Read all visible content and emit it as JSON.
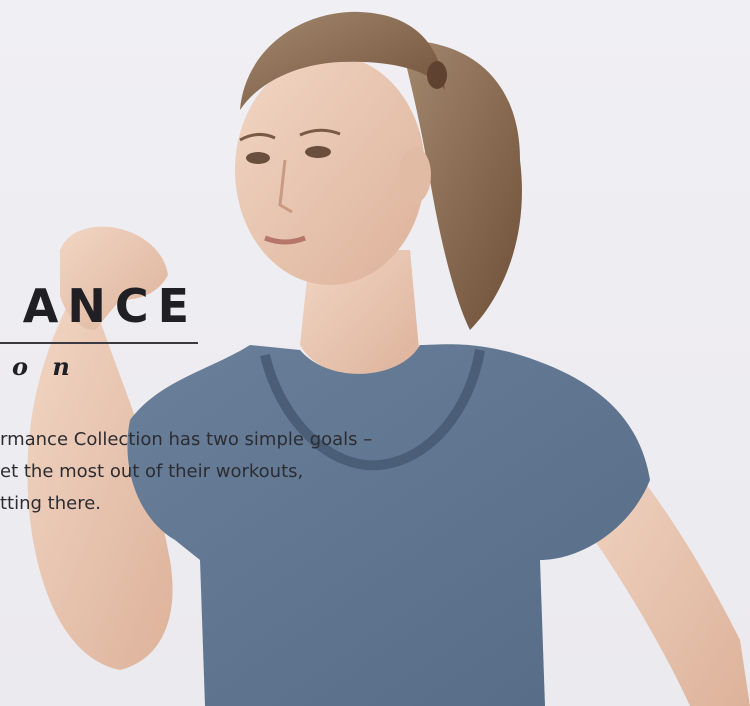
{
  "hero": {
    "headline": "ANCE",
    "subheadline": "o n",
    "body_lines": [
      "rmance Collection has two simple goals –",
      "et the most out of their workouts,",
      "tting there."
    ]
  },
  "colors": {
    "background": "#eeedf1",
    "shirt": "#5e7590",
    "skin": "#e9c7b2",
    "hair": "#8a6a4f",
    "text": "#1f1f24"
  }
}
